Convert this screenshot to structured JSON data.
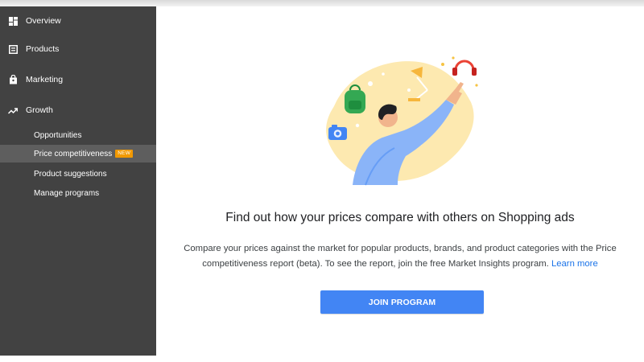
{
  "sidebar": {
    "items": [
      {
        "label": "Overview",
        "icon": "dashboard-icon"
      },
      {
        "label": "Products",
        "icon": "product-list-icon"
      },
      {
        "label": "Marketing",
        "icon": "shopping-bag-icon"
      },
      {
        "label": "Growth",
        "icon": "trending-up-icon"
      }
    ],
    "growth_subitems": [
      {
        "label": "Opportunities"
      },
      {
        "label": "Price competitiveness",
        "badge": "NEW",
        "active": true
      },
      {
        "label": "Product suggestions"
      },
      {
        "label": "Manage programs"
      }
    ]
  },
  "main": {
    "illustration": "person-pointing-at-products-illustration",
    "headline": "Find out how your prices compare with others on Shopping ads",
    "description": "Compare your prices against the market for popular products, brands, and product categories with the Price competitiveness report (beta). To see the report, join the free Market Insights program.",
    "learn_more": "Learn more",
    "join_button": "JOIN PROGRAM"
  },
  "colors": {
    "sidebar_bg": "#424242",
    "active_bg": "#5e5e5e",
    "badge": "#f29900",
    "accent_button": "#4285f4",
    "link": "#1a73e8"
  }
}
